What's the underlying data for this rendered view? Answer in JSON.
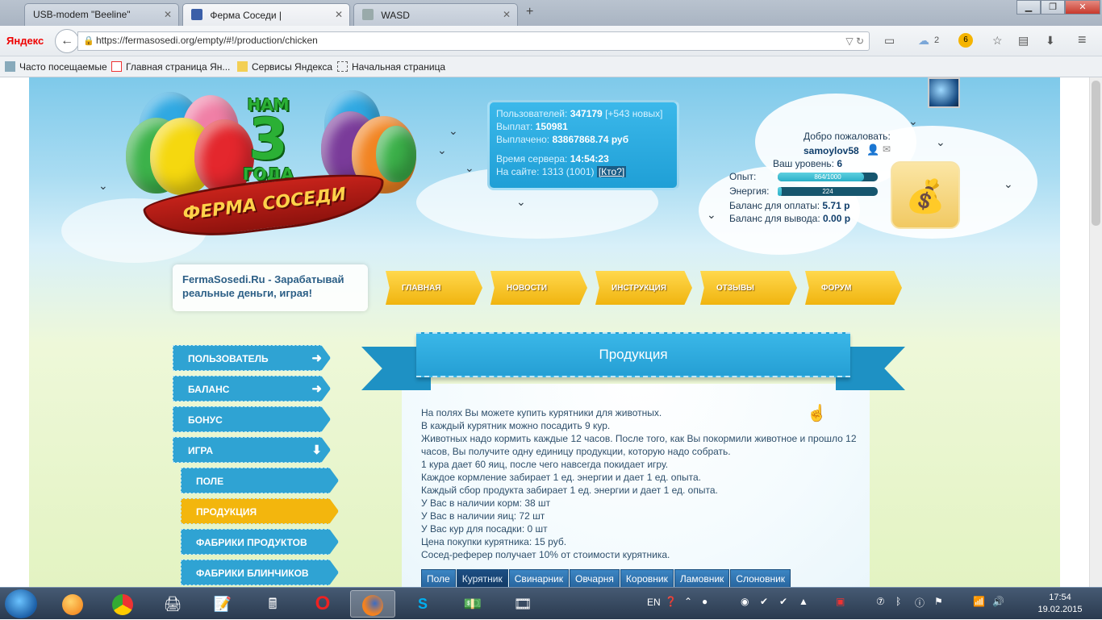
{
  "browser": {
    "tabs": [
      {
        "title": "USB-modem \"Beeline\"",
        "active": false
      },
      {
        "title": "Ферма Соседи |",
        "active": true
      },
      {
        "title": "WASD",
        "active": false
      }
    ],
    "new_tab": "+",
    "url": "https://fermasosedi.org/empty/#!/production/chicken",
    "brand": "Яндекс",
    "cloud_count": "2",
    "badge_count": "6",
    "bookmarks": [
      "Часто посещаемые",
      "Главная страница Ян...",
      "Сервисы Яндекса",
      "Начальная страница"
    ]
  },
  "logo": {
    "years_top": "НАМ",
    "years_number": "3",
    "years_bottom": "ГОДА",
    "ribbon": "ФЕРМА СОСЕДИ"
  },
  "stats": {
    "users_label": "Пользователей:",
    "users_value": "347179",
    "users_new": "[+543 новых]",
    "payouts_label": "Выплат:",
    "payouts_value": "150981",
    "paid_label": "Выплачено:",
    "paid_value": "83867868.74 руб",
    "server_time_label": "Время сервера:",
    "server_time_value": "14:54:23",
    "online_label": "На сайте:",
    "online_value": "1313 (1001)",
    "who_link": "[Кто?]"
  },
  "user": {
    "welcome": "Добро пожаловать:",
    "username": "samoylov58",
    "level_label": "Ваш уровень:",
    "level_value": "6",
    "xp_label": "Опыт:",
    "xp_text": "864/1000",
    "xp_fraction": 0.864,
    "energy_label": "Энергия:",
    "energy_text": "224",
    "energy_fraction": 0.04,
    "balance_pay_label": "Баланс для оплаты:",
    "balance_pay_value": "5.71 р",
    "balance_out_label": "Баланс для вывода:",
    "balance_out_value": "0.00 р"
  },
  "slogan": "FermaSosedi.Ru - Зарабатывай реальные деньги, играя!",
  "top_menu": [
    "ГЛАВНАЯ",
    "НОВОСТИ",
    "ИНСТРУКЦИЯ",
    "ОТЗЫВЫ",
    "ФОРУМ"
  ],
  "side_menu": [
    {
      "label": "ПОЛЬЗОВАТЕЛЬ",
      "icon": "arrow-right-icon"
    },
    {
      "label": "БАЛАНС",
      "icon": "arrow-right-icon"
    },
    {
      "label": "БОНУС",
      "icon": ""
    },
    {
      "label": "ИГРА",
      "icon": "arrow-down-icon"
    },
    {
      "label": "ПОЛЕ",
      "icon": ""
    },
    {
      "label": "ПРОДУКЦИЯ",
      "icon": ""
    },
    {
      "label": "ФАБРИКИ ПРОДУКТОВ",
      "icon": ""
    },
    {
      "label": "ФАБРИКИ БЛИНЧИКОВ",
      "icon": ""
    }
  ],
  "production": {
    "title": "Продукция",
    "lines": [
      "На полях Вы можете купить курятники для животных.",
      "В каждый курятник можно посадить 9 кур.",
      "Животных надо кормить каждые 12 часов. После того, как Вы покормили животное и прошло 12 часов, Вы получите одну единицу продукции, которую надо собрать.",
      "1 кура дает 60 яиц, после чего навсегда покидает игру.",
      "Каждое кормление забирает 1 ед. энергии и дает 1 ед. опыта.",
      "Каждый сбор продукта забирает 1 ед. энергии и дает 1 ед. опыта.",
      "У Вас в наличии корм: 38 шт",
      "У Вас в наличии яиц: 72 шт",
      "У Вас кур для посадки: 0 шт",
      "Цена покупки курятника: 15 руб.",
      "Сосед-реферер получает 10% от стоимости курятника."
    ],
    "tabs": [
      "Поле",
      "Курятник",
      "Свинарник",
      "Овчарня",
      "Коровник",
      "Ламовник",
      "Слоновник"
    ],
    "active_tab": "Курятник"
  },
  "taskbar": {
    "lang": "EN",
    "time": "17:54",
    "date": "19.02.2015"
  }
}
